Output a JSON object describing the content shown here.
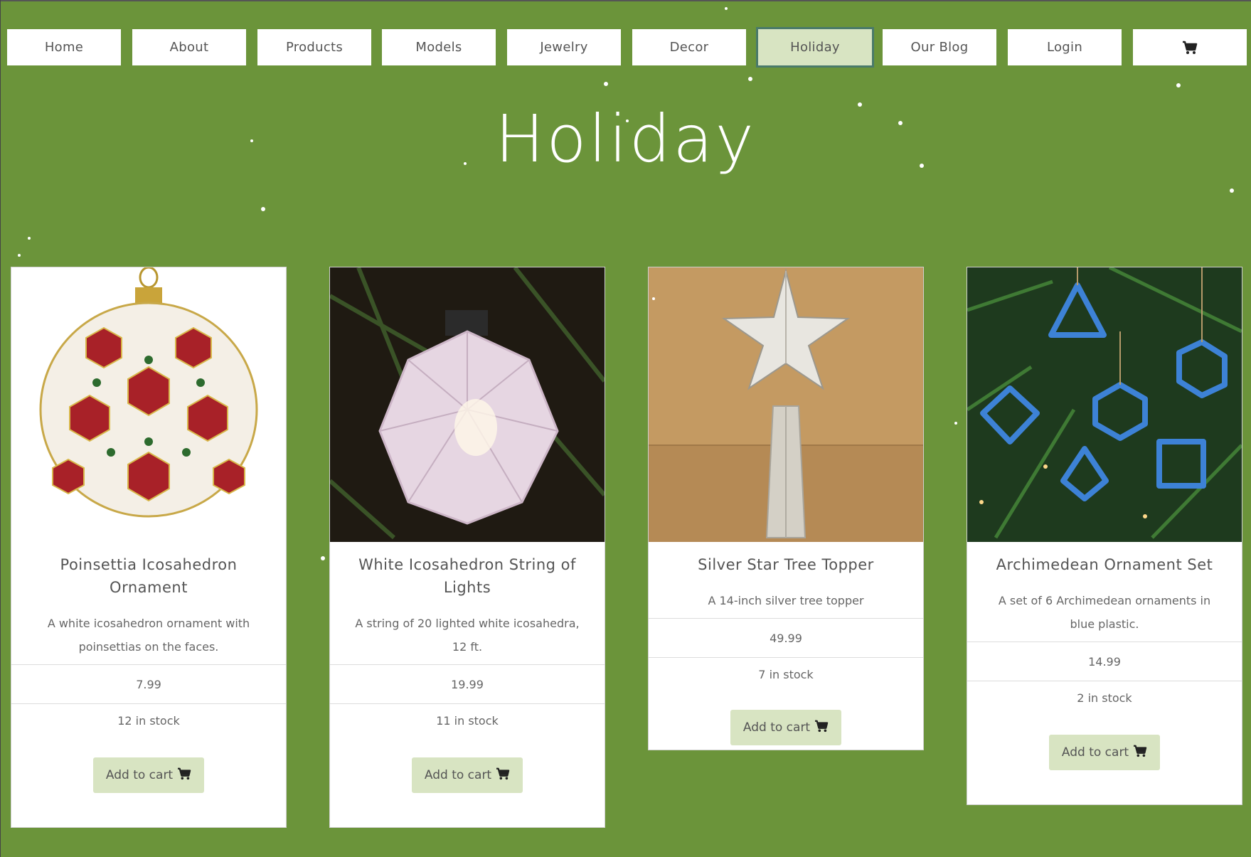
{
  "nav": {
    "items": [
      {
        "label": "Home"
      },
      {
        "label": "About"
      },
      {
        "label": "Products"
      },
      {
        "label": "Models"
      },
      {
        "label": "Jewelry"
      },
      {
        "label": "Decor"
      },
      {
        "label": "Holiday",
        "active": true
      },
      {
        "label": "Our Blog"
      },
      {
        "label": "Login"
      }
    ],
    "cart_icon": "shopping-cart-icon"
  },
  "page": {
    "title": "Holiday"
  },
  "products": [
    {
      "title": "Poinsettia Icosahedron Ornament",
      "description": "A white icosahedron ornament with poinsettias on the faces.",
      "price": "7.99",
      "stock": "12 in stock",
      "button": "Add to cart",
      "image": "poinsettia-ornament-image"
    },
    {
      "title": "White Icosahedron String of Lights",
      "description": "A string of 20 lighted white icosahedra, 12 ft.",
      "price": "19.99",
      "stock": "11 in stock",
      "button": "Add to cart",
      "image": "white-icosahedron-lights-image"
    },
    {
      "title": "Silver Star Tree Topper",
      "description": "A 14-inch silver tree topper",
      "price": "49.99",
      "stock": "7 in stock",
      "button": "Add to cart",
      "image": "silver-star-topper-image"
    },
    {
      "title": "Archimedean Ornament Set",
      "description": "A set of 6 Archimedean ornaments in blue plastic.",
      "price": "14.99",
      "stock": "2 in stock",
      "button": "Add to cart",
      "image": "archimedean-ornaments-image"
    }
  ],
  "colors": {
    "background": "#6b943a",
    "nav_active": "#d8e4c2",
    "button": "#d8e4c2"
  }
}
